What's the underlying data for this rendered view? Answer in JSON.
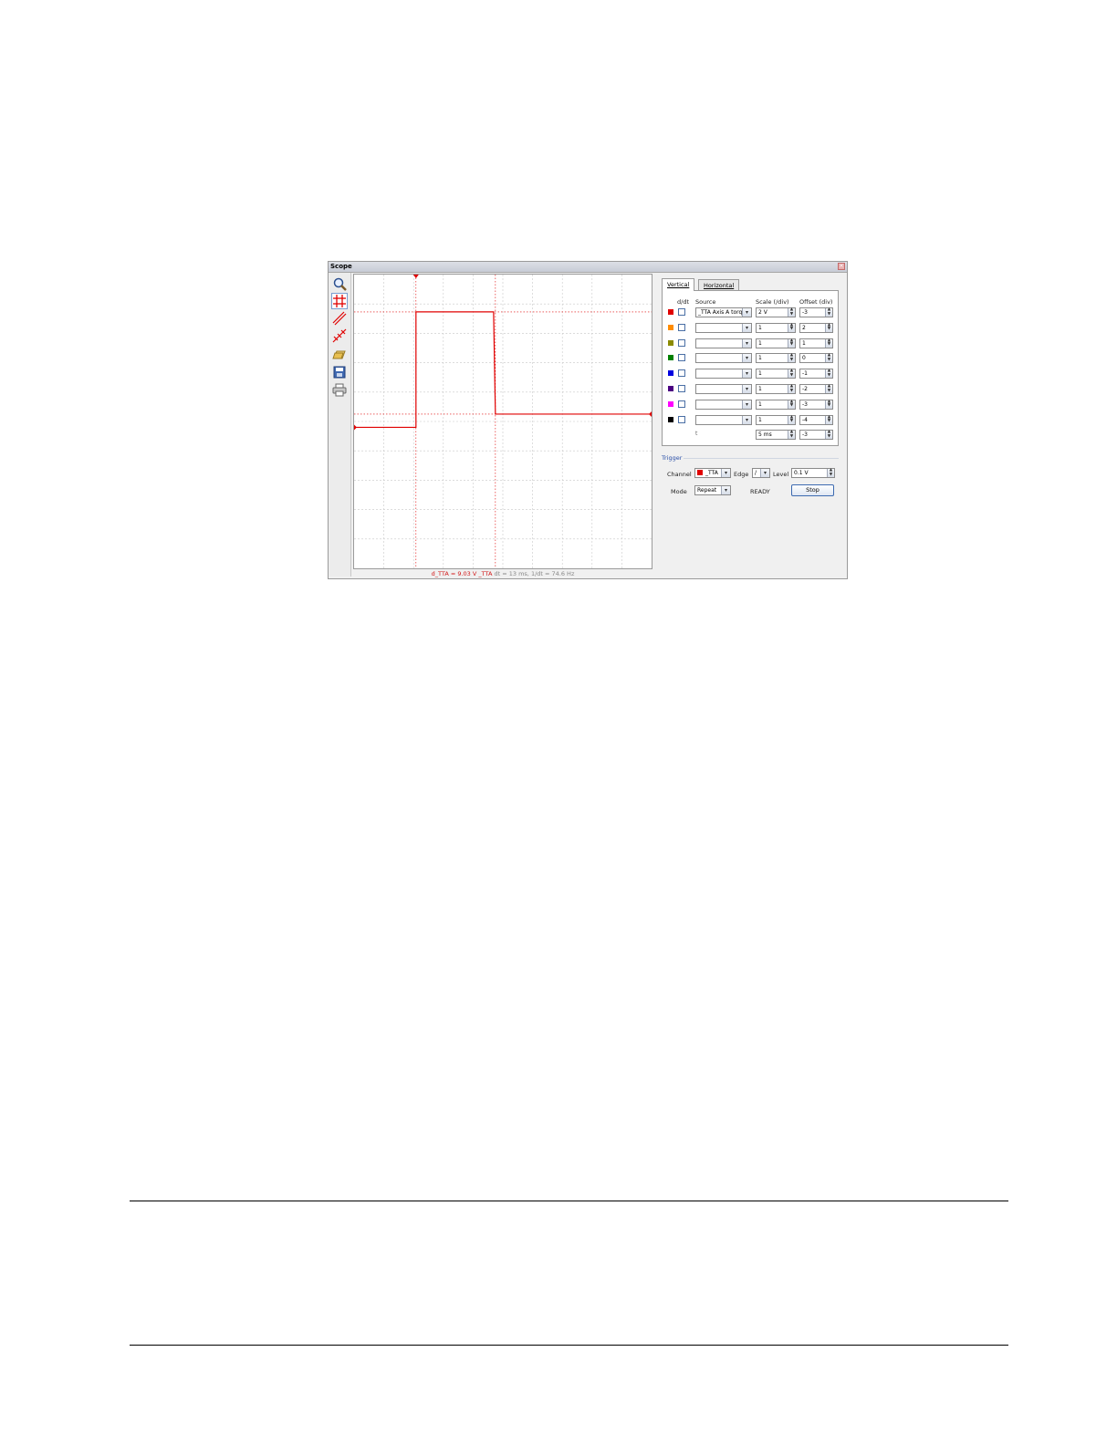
{
  "window": {
    "title": "Scope",
    "close_glyph": "×"
  },
  "toolbar": [
    {
      "name": "zoom-icon"
    },
    {
      "name": "grid-icon"
    },
    {
      "name": "cursor-lines-icon"
    },
    {
      "name": "cursor-markers-icon"
    },
    {
      "name": "open-folder-icon"
    },
    {
      "name": "save-icon"
    },
    {
      "name": "print-icon"
    }
  ],
  "readout": {
    "value": "d_TTA = 9.03 V _TTA",
    "time": "dt = 13 ms, 1/dt = 74.6 Hz"
  },
  "tabs": {
    "vertical": "Vertical",
    "horizontal": "Horizontal"
  },
  "headers": {
    "ddt": "d/dt",
    "source": "Source",
    "scale": "Scale (/div)",
    "offset": "Offset (div)"
  },
  "channels": [
    {
      "color": "#e00000",
      "source": "_TTA Axis A torq",
      "scale": "2 V",
      "offset": "-3"
    },
    {
      "color": "#ff8c00",
      "source": "",
      "scale": "1",
      "offset": "2"
    },
    {
      "color": "#8b8b00",
      "source": "",
      "scale": "1",
      "offset": "1"
    },
    {
      "color": "#008000",
      "source": "",
      "scale": "1",
      "offset": "0"
    },
    {
      "color": "#0000e0",
      "source": "",
      "scale": "1",
      "offset": "-1"
    },
    {
      "color": "#4b0082",
      "source": "",
      "scale": "1",
      "offset": "-2"
    },
    {
      "color": "#ff00ff",
      "source": "",
      "scale": "1",
      "offset": "-3"
    },
    {
      "color": "#000000",
      "source": "",
      "scale": "1",
      "offset": "-4"
    }
  ],
  "time_row": {
    "label": "t",
    "scale": "5 ms",
    "offset": "-3"
  },
  "trigger": {
    "title": "Trigger",
    "channel_label": "Channel",
    "channel_value": "_TTA",
    "channel_color": "#e00000",
    "edge_label": "Edge",
    "edge_value": "/",
    "level_label": "Level",
    "level_value": "0.1 V",
    "mode_label": "Mode",
    "mode_value": "Repeat",
    "status": "READY",
    "stop_label": "Stop"
  },
  "glyphs": {
    "dropdown": "▾",
    "spin_up": "▲",
    "spin_down": "▼"
  },
  "trace": {
    "color": "#e00000",
    "low_div": 4.8,
    "high_div": 8.73,
    "post_div": 5.25
  }
}
